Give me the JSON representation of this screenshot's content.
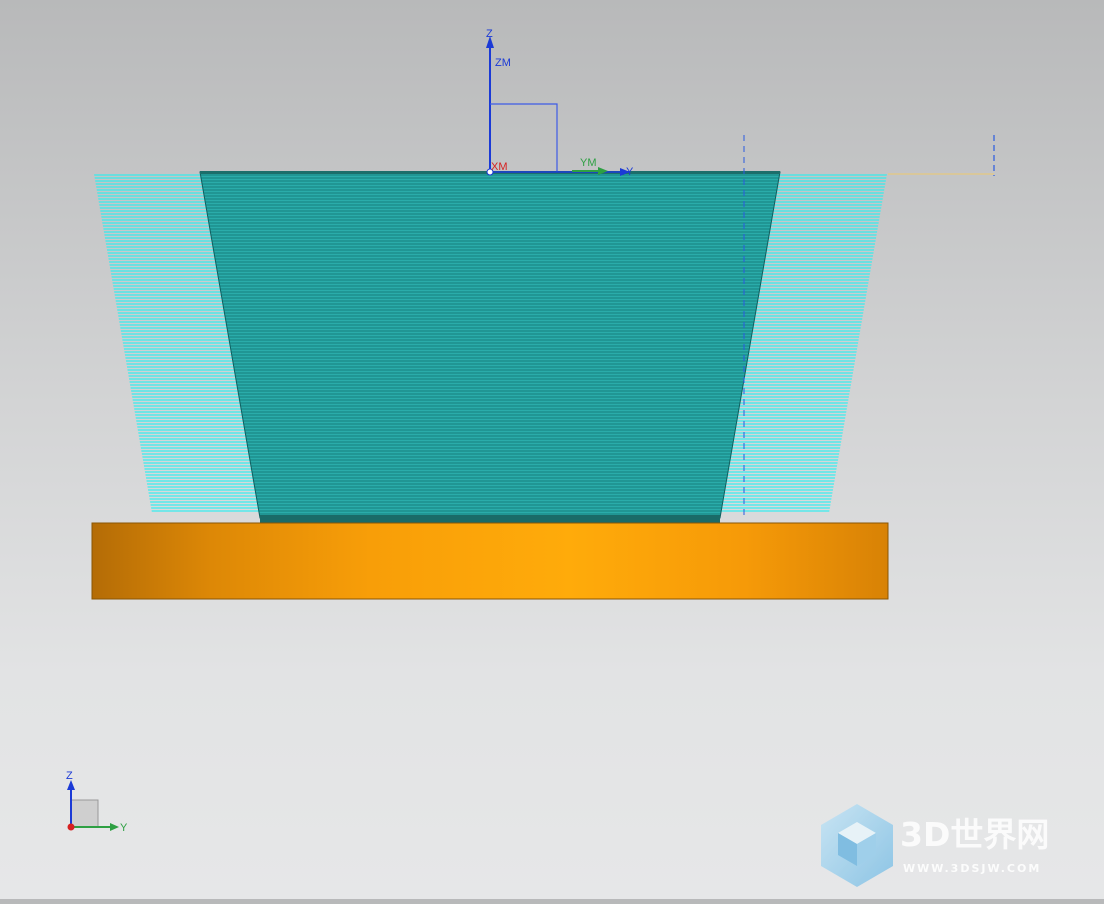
{
  "viewport": {
    "axis_labels": {
      "z": "Z",
      "zm": "ZM",
      "xm": "XM",
      "ym": "YM",
      "y": "Y"
    },
    "triad_labels": {
      "z": "Z",
      "y": "Y"
    }
  },
  "watermark": {
    "title": "3D世界网",
    "url": "WWW.3DSJW.COM",
    "logo_icon": "cube-logo-icon"
  },
  "colors": {
    "toolpath_light": "#22eef0",
    "part_face": "#1fa5a5",
    "part_edge": "#0e6060",
    "base": "#f39a0a",
    "axis_blue": "#1b3ad6",
    "axis_green": "#2ea043",
    "axis_red": "#d62020"
  }
}
